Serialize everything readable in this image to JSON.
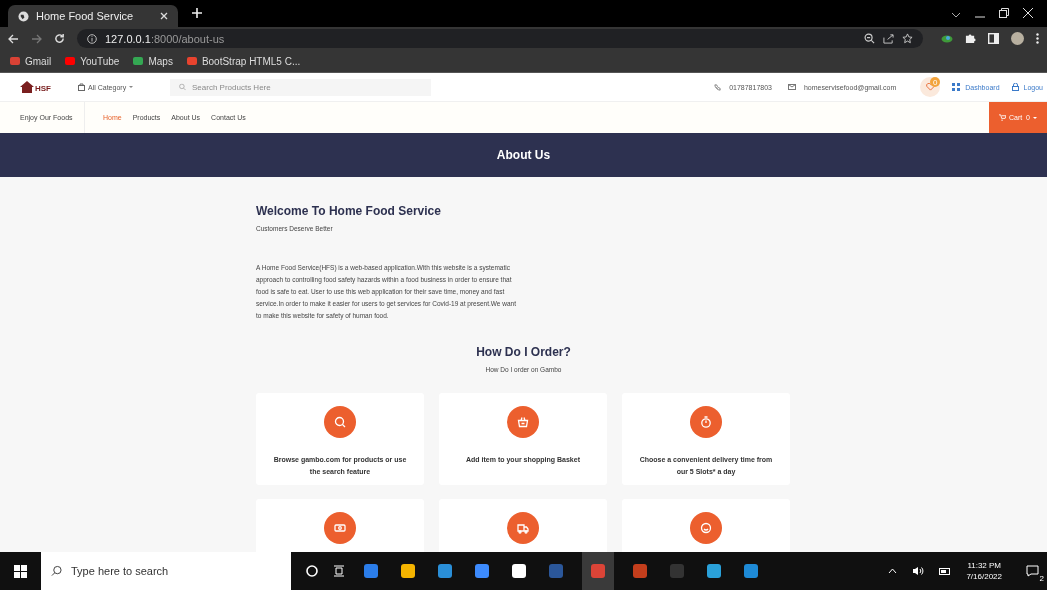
{
  "browser": {
    "tabs": [
      {
        "title": "Home Food Service",
        "selected": true
      }
    ],
    "address": {
      "host": "127.0.0.1",
      "rest": ":8000/about-us"
    },
    "bookmarks": [
      "Gmail",
      "YouTube",
      "Maps",
      "BootStrap HTML5 C..."
    ]
  },
  "header": {
    "logo": "HSF",
    "category": "All Category",
    "search_placeholder": "Search Products Here",
    "phone": "01787817803",
    "email": "homeservisefood@gmail.com",
    "wishlist_count": "0",
    "dashboard": "Dashboard",
    "logout": "Logou"
  },
  "nav": {
    "tagline": "Enjoy Our Foods",
    "links": [
      {
        "label": "Home",
        "selected": true
      },
      {
        "label": "Products",
        "selected": false
      },
      {
        "label": "About Us",
        "selected": false
      },
      {
        "label": "Contact Us",
        "selected": false
      }
    ],
    "cart": {
      "label": "Cart",
      "count": "0"
    }
  },
  "banner": {
    "title": "About Us"
  },
  "about": {
    "title": "Welcome To Home Food Service",
    "subtitle": "Customers Deserve Better",
    "body": "A Home Food Service(HFS) is a web-based application.With this website is a systematic approach to controlling food safety hazards within a food business in order to ensure that food is safe to eat. User to use this web application for their save time, money and fast service.In order to make it easier for users to get services for Covid-19 at present.We want to make this website for safety of human food."
  },
  "order": {
    "title": "How Do I Order?",
    "subtitle": "How Do I order on Gambo",
    "steps": [
      {
        "kind": "captioned",
        "text": "Browse gambo.com for products or use the search feature"
      },
      {
        "kind": "captioned",
        "text": "Add item to your shopping Basket"
      },
      {
        "kind": "captioned",
        "text": "Choose a convenient delivery time from our 5 Slots* a day"
      },
      {
        "kind": "icon_only"
      },
      {
        "kind": "icon_only"
      },
      {
        "kind": "icon_only"
      }
    ]
  },
  "taskbar": {
    "search_placeholder": "Type here to search",
    "time": "11:32 PM",
    "date": "7/16/2022",
    "notifications": "2"
  }
}
